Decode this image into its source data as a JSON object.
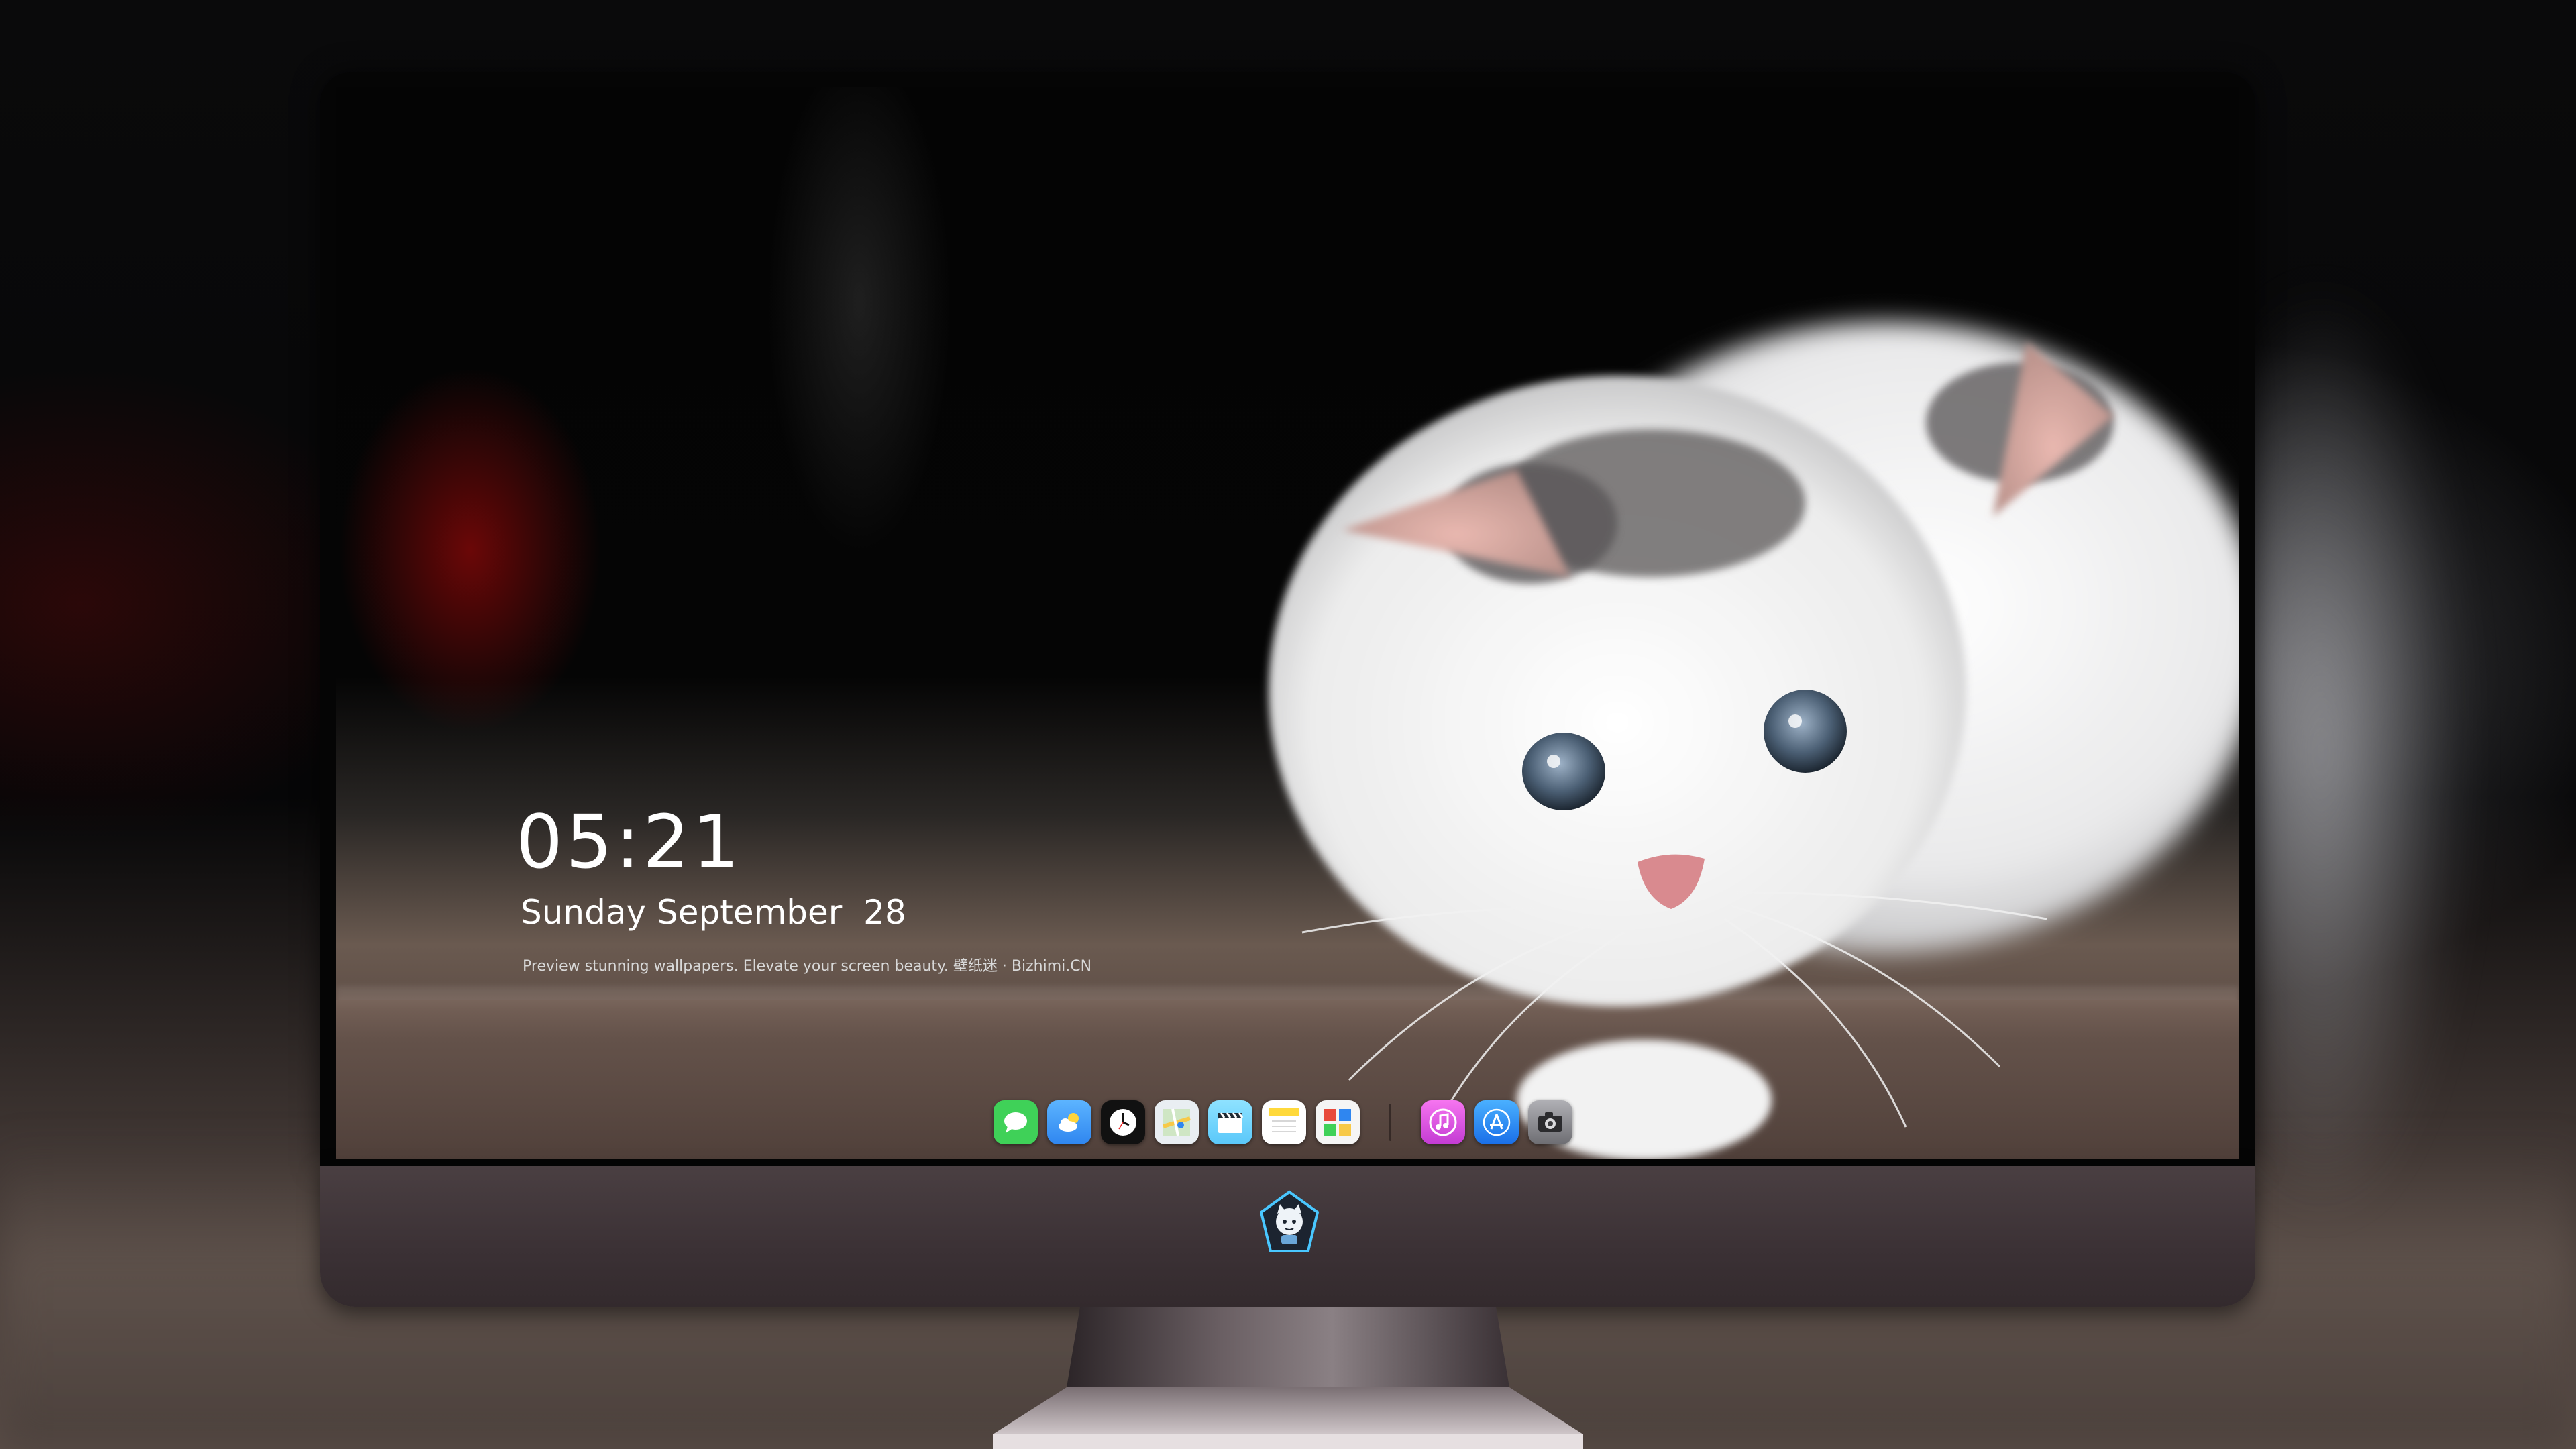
{
  "lockscreen": {
    "time": "05:21",
    "date": "Sunday September  28",
    "tagline": "Preview stunning wallpapers. Elevate your screen beauty. 壁纸迷 · Bizhimi.CN"
  },
  "dock": {
    "apps": [
      {
        "name": "messages",
        "icon": "messages-icon",
        "color": "#3fd158"
      },
      {
        "name": "weather",
        "icon": "weather-icon",
        "color": "#2f86f0"
      },
      {
        "name": "clock",
        "icon": "clock-icon",
        "color": "#111111"
      },
      {
        "name": "maps",
        "icon": "maps-icon",
        "color": "#e9eef2"
      },
      {
        "name": "videos",
        "icon": "clapper-icon",
        "color": "#5ac8fa"
      },
      {
        "name": "notes",
        "icon": "notes-icon",
        "color": "#ffe066"
      },
      {
        "name": "photo-booth",
        "icon": "photo-booth-icon",
        "color": "#f5f5f5"
      },
      {
        "name": "itunes",
        "icon": "music-note-icon",
        "color": "#e14fd8"
      },
      {
        "name": "app-store",
        "icon": "app-store-icon",
        "color": "#1a8cff"
      },
      {
        "name": "camera",
        "icon": "camera-icon",
        "color": "#8e8e93"
      }
    ]
  },
  "monitor": {
    "logo": "bizhimi-mascot-logo"
  }
}
